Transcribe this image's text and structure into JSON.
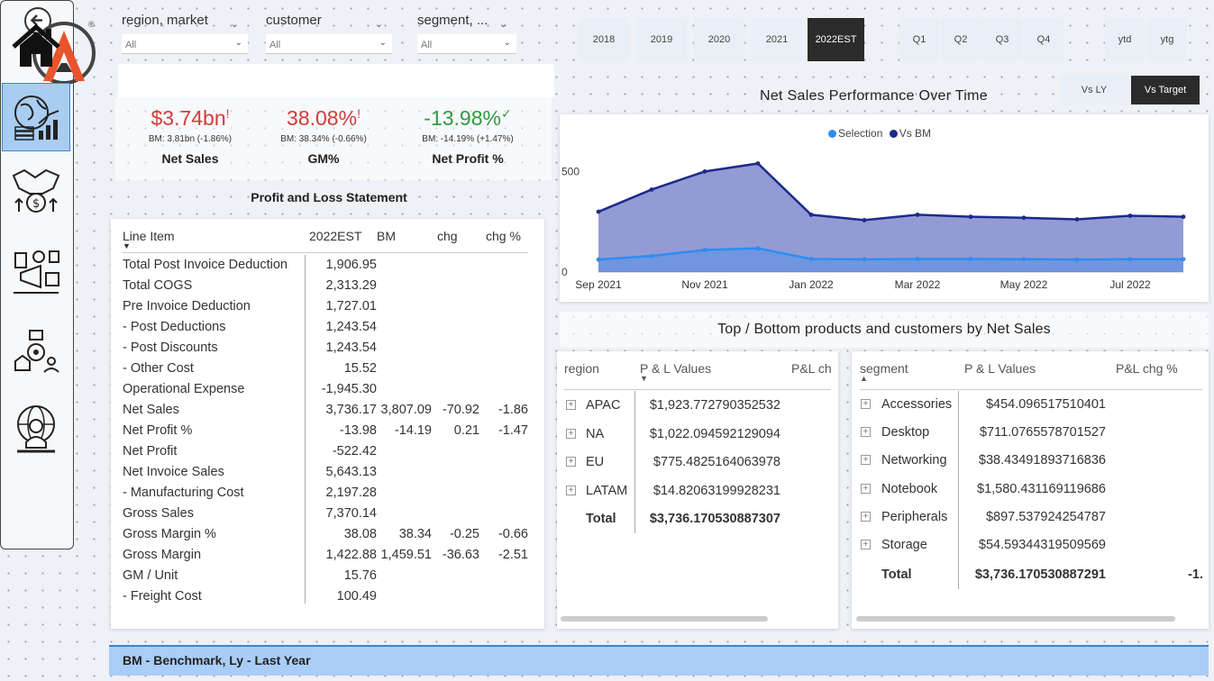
{
  "filters": [
    {
      "label": "region, market",
      "value": "All"
    },
    {
      "label": "customer",
      "value": "All"
    },
    {
      "label": "segment, ...",
      "value": "All"
    }
  ],
  "kpis": [
    {
      "value": "$3.74bn",
      "flag": "!",
      "bm": "BM: 3.81bn (-1.86%)",
      "name": "Net Sales",
      "status": "bad"
    },
    {
      "value": "38.08%",
      "flag": "!",
      "bm": "BM: 38.34% (-0.66%)",
      "name": "GM%",
      "status": "bad"
    },
    {
      "value": "-13.98%",
      "flag": "✓",
      "bm": "BM: -14.19% (+1.47%)",
      "name": "Net Profit %",
      "status": "good"
    }
  ],
  "pl": {
    "title": "Profit and Loss Statement",
    "headers": [
      "Line Item",
      "2022EST",
      "BM",
      "chg",
      "chg %"
    ],
    "rows": [
      [
        "Total Post Invoice Deduction",
        "1,906.95",
        "",
        "",
        ""
      ],
      [
        "Total COGS",
        "2,313.29",
        "",
        "",
        ""
      ],
      [
        "Pre Invoice Deduction",
        "1,727.01",
        "",
        "",
        ""
      ],
      [
        "- Post Deductions",
        "1,243.54",
        "",
        "",
        ""
      ],
      [
        "- Post Discounts",
        "1,243.54",
        "",
        "",
        ""
      ],
      [
        "- Other Cost",
        "15.52",
        "",
        "",
        ""
      ],
      [
        "Operational Expense",
        "-1,945.30",
        "",
        "",
        ""
      ],
      [
        "Net Sales",
        "3,736.17",
        "3,807.09",
        "-70.92",
        "-1.86"
      ],
      [
        "Net Profit %",
        "-13.98",
        "-14.19",
        "0.21",
        "-1.47"
      ],
      [
        "Net Profit",
        "-522.42",
        "",
        "",
        ""
      ],
      [
        "Net Invoice Sales",
        "5,643.13",
        "",
        "",
        ""
      ],
      [
        "- Manufacturing Cost",
        "2,197.28",
        "",
        "",
        ""
      ],
      [
        "Gross Sales",
        "7,370.14",
        "",
        "",
        ""
      ],
      [
        "Gross Margin %",
        "38.08",
        "38.34",
        "-0.25",
        "-0.66"
      ],
      [
        "Gross Margin",
        "1,422.88",
        "1,459.51",
        "-36.63",
        "-2.51"
      ],
      [
        "GM / Unit",
        "15.76",
        "",
        "",
        ""
      ],
      [
        "- Freight Cost",
        "100.49",
        "",
        "",
        ""
      ]
    ]
  },
  "years": [
    "2018",
    "2019",
    "2020",
    "2021",
    "2022EST"
  ],
  "selected_year": "2022EST",
  "quarters": [
    "Q1",
    "Q2",
    "Q3",
    "Q4"
  ],
  "periods": [
    "ytd",
    "ytg"
  ],
  "compare": [
    "Vs LY",
    "Vs Target"
  ],
  "selected_compare": "Vs Target",
  "chart_data": {
    "type": "area",
    "title": "Net Sales Performance Over Time",
    "x": [
      "Sep 2021",
      "Oct 2021",
      "Nov 2021",
      "Dec 2021",
      "Jan 2022",
      "Feb 2022",
      "Mar 2022",
      "Apr 2022",
      "May 2022",
      "Jun 2022",
      "Jul 2022",
      "Aug 2022"
    ],
    "x_tick_labels": [
      "Sep 2021",
      "Nov 2021",
      "Jan 2022",
      "Mar 2022",
      "May 2022",
      "Jul 2022"
    ],
    "series": [
      {
        "name": "Selection",
        "color": "#2f8cf0",
        "values": [
          62,
          80,
          110,
          118,
          65,
          63,
          65,
          65,
          64,
          62,
          64,
          64
        ]
      },
      {
        "name": "Vs BM",
        "color": "#1c2a8c",
        "values": [
          300,
          410,
          500,
          540,
          285,
          258,
          285,
          275,
          270,
          262,
          280,
          275
        ]
      }
    ],
    "ylim": [
      0,
      560
    ],
    "y_ticks": [
      0,
      500
    ],
    "legend": "top-center"
  },
  "top_bottom_title": "Top / Bottom products and customers by Net Sales",
  "region_table": {
    "headers": [
      "region",
      "P & L Values",
      "P&L ch"
    ],
    "rows": [
      [
        "APAC",
        "$1,923.772790352532"
      ],
      [
        "NA",
        "$1,022.094592129094"
      ],
      [
        "EU",
        "$775.4825164063978"
      ],
      [
        "LATAM",
        "$14.82063199928231"
      ]
    ],
    "total_label": "Total",
    "total_value": "$3,736.170530887307"
  },
  "segment_table": {
    "headers": [
      "segment",
      "P & L Values",
      "P&L chg %"
    ],
    "rows": [
      [
        "Accessories",
        "$454.096517510401"
      ],
      [
        "Desktop",
        "$711.0765578701527"
      ],
      [
        "Networking",
        "$38.43491893716836"
      ],
      [
        "Notebook",
        "$1,580.431169119686"
      ],
      [
        "Peripherals",
        "$897.537924254787"
      ],
      [
        "Storage",
        "$54.59344319509569"
      ]
    ],
    "total_label": "Total",
    "total_value": "$3,736.170530887291",
    "total_chg": "-1."
  },
  "footer": "BM - Benchmark, Ly - Last Year",
  "colors": {
    "accent": "#d33a3a",
    "good": "#2e9a3e",
    "selected": "#2b2b2b",
    "nav_active": "#a9cdf0"
  }
}
